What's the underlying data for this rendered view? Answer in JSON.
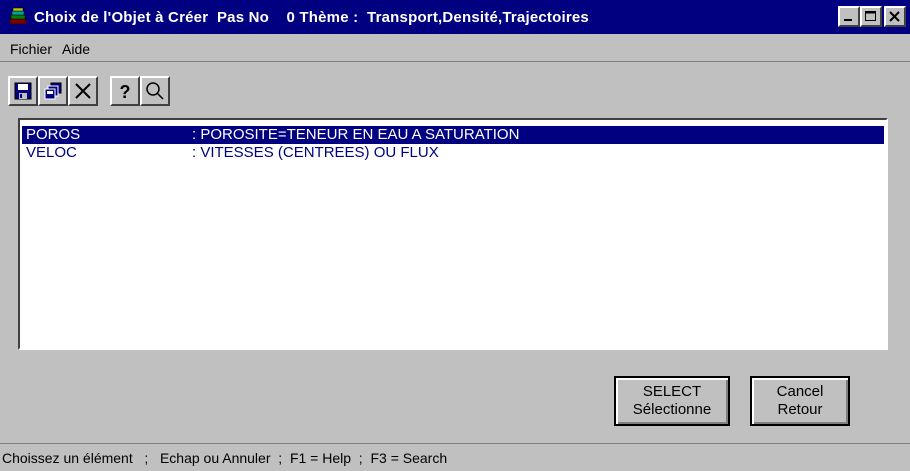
{
  "window": {
    "title": "Choix de l'Objet à Créer  Pas No    0 Thème :  Transport,Densité,Trajectoires"
  },
  "menu": {
    "items": [
      "Fichier",
      "Aide"
    ]
  },
  "toolbar": {
    "icons": [
      "save-icon",
      "copy-icon",
      "delete-icon",
      "help-icon",
      "search-icon"
    ]
  },
  "list": {
    "rows": [
      {
        "code": "POROS",
        "description": ": POROSITE=TENEUR EN EAU A SATURATION",
        "selected": true
      },
      {
        "code": "VELOC",
        "description": ": VITESSES (CENTREES) OU FLUX",
        "selected": false
      }
    ]
  },
  "buttons": {
    "select_line1": "SELECT",
    "select_line2": "Sélectionne",
    "cancel_line1": "Cancel",
    "cancel_line2": "Retour"
  },
  "status": {
    "text": "Choissez un élément   ;   Echap ou Annuler  ;  F1 = Help  ;  F3 = Search"
  },
  "colors": {
    "titlebar": "#000080",
    "face": "#c0c0c0",
    "selection": "#000080"
  }
}
